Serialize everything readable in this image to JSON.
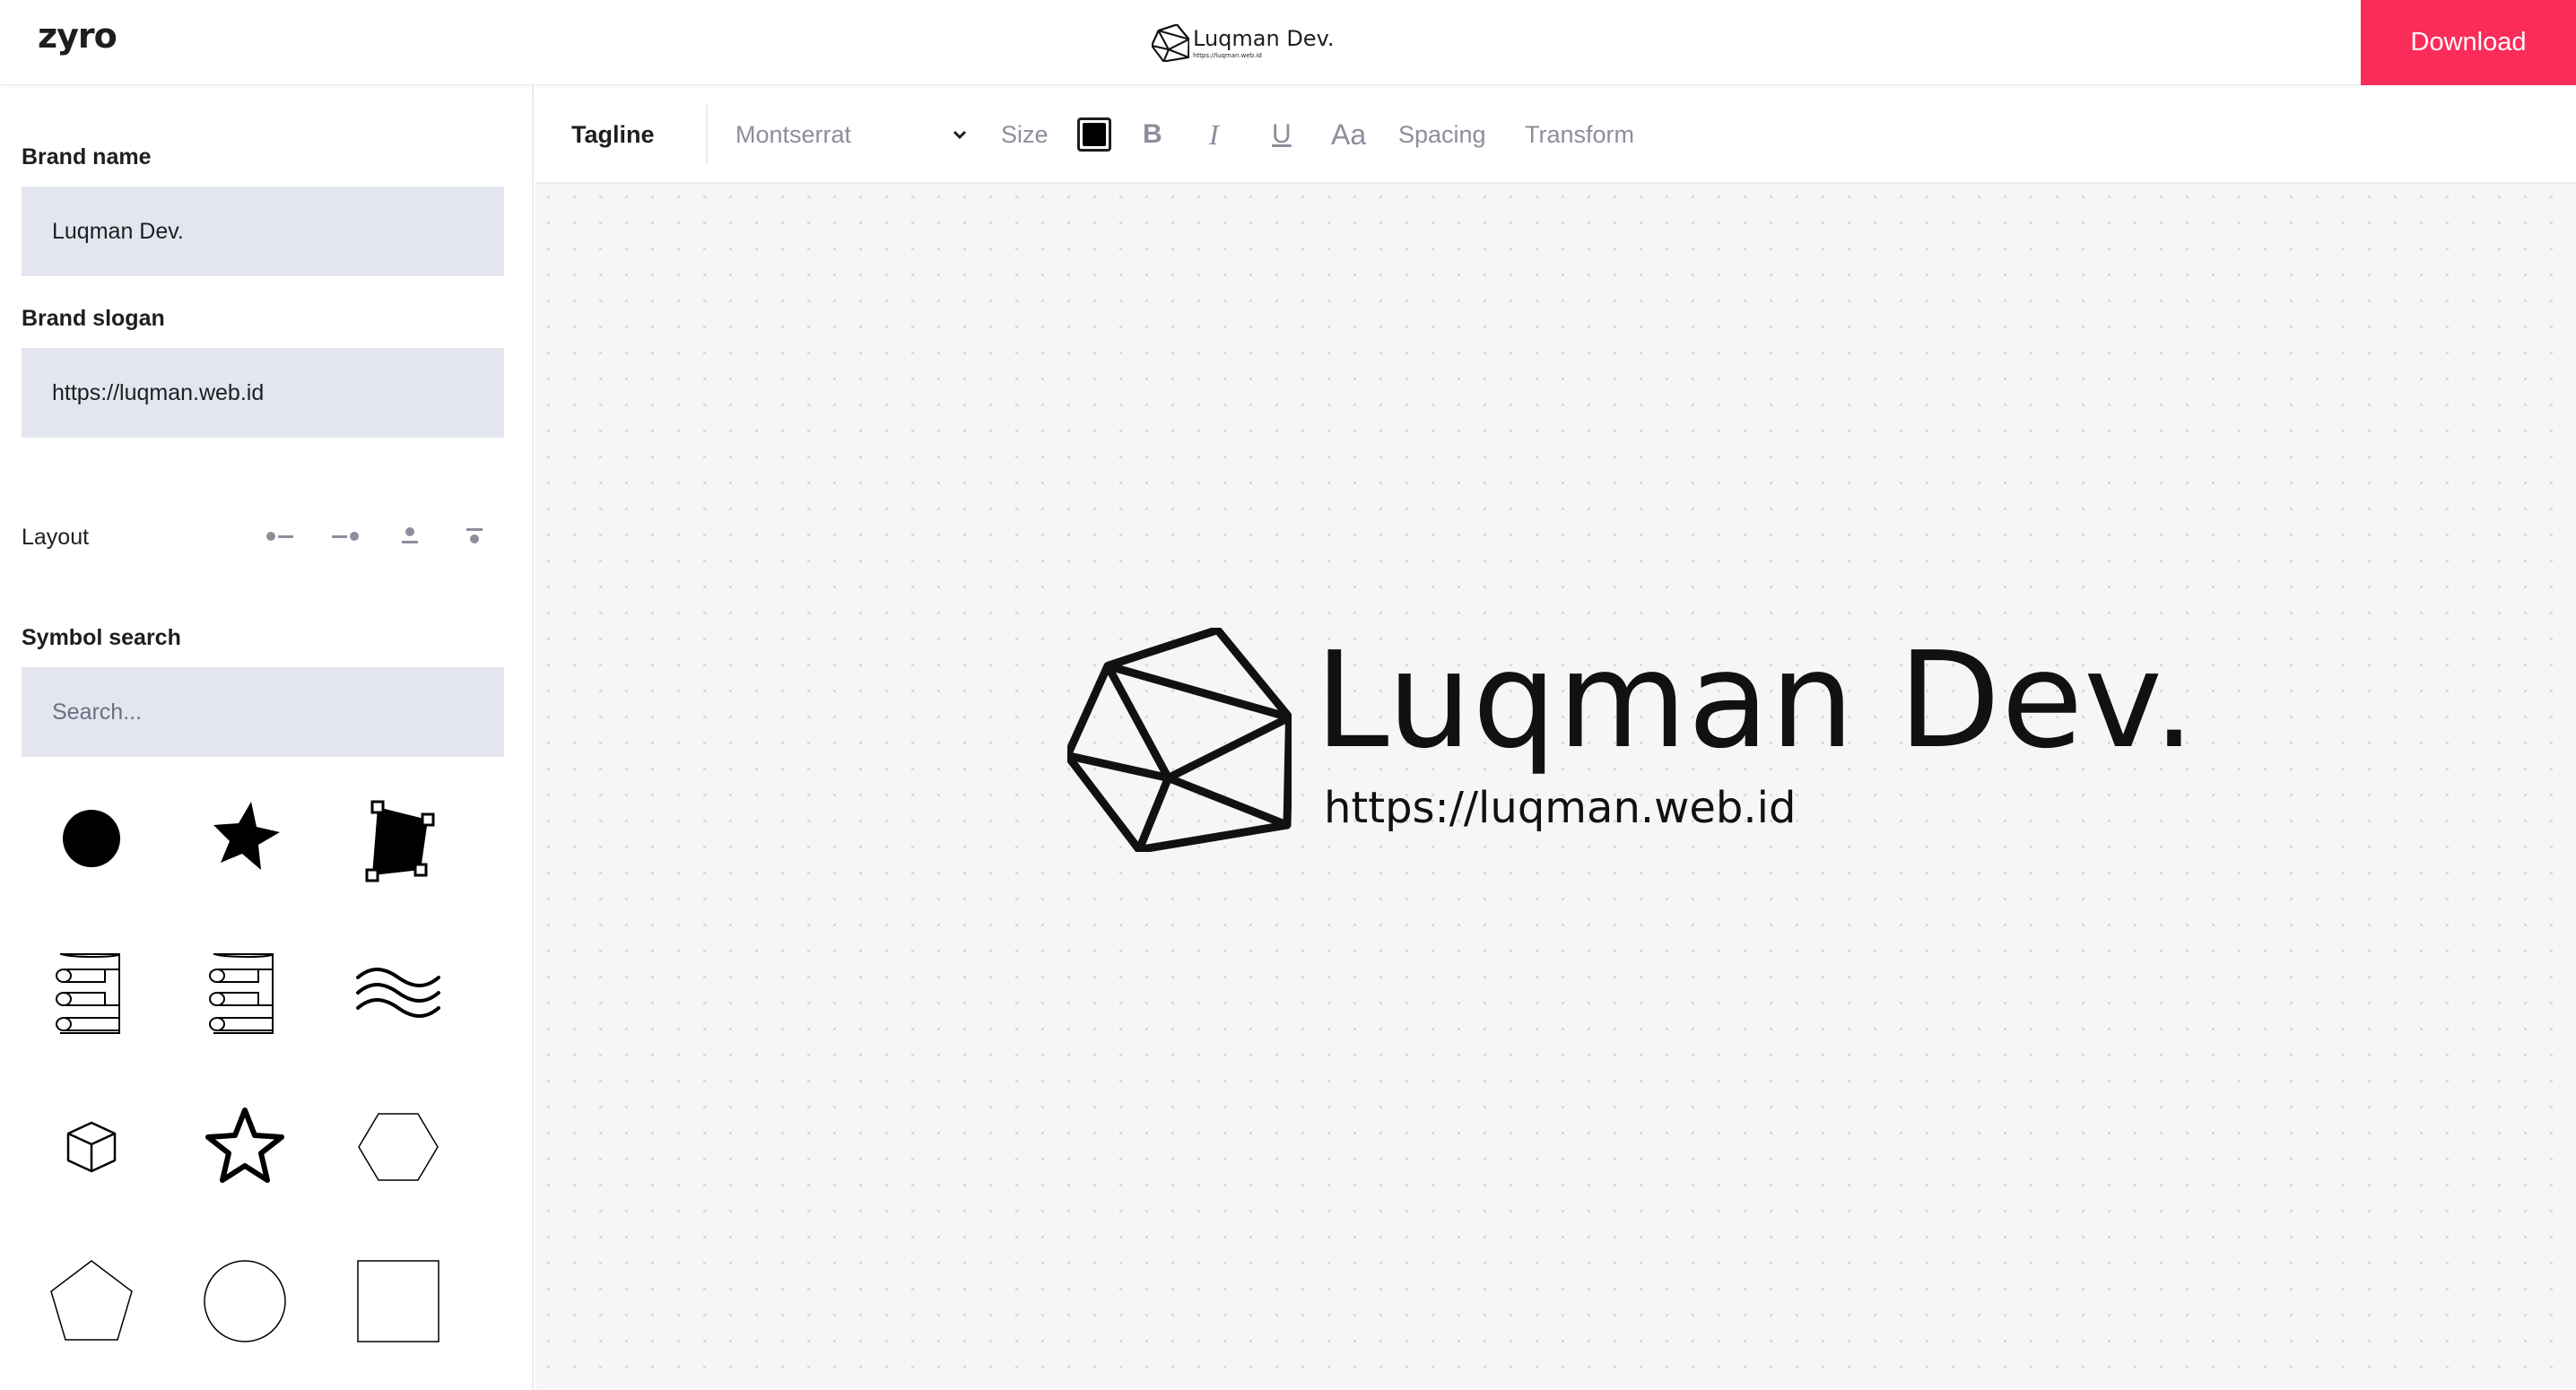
{
  "app": {
    "brand": "zyro"
  },
  "header": {
    "preview_name": "Luqman Dev.",
    "preview_slogan": "https://luqman.web.id",
    "download_label": "Download",
    "accent_color": "#fc2c5a"
  },
  "sidebar": {
    "brand_name_label": "Brand name",
    "brand_name_value": "Luqman Dev.",
    "brand_slogan_label": "Brand slogan",
    "brand_slogan_value": "https://luqman.web.id",
    "layout_label": "Layout",
    "layout_options": [
      "icon-left",
      "icon-right",
      "icon-top",
      "icon-top-centered"
    ],
    "symbol_search_label": "Symbol search",
    "symbol_search_placeholder": "Search...",
    "symbols": [
      "filled-circle-icon",
      "filled-star-icon",
      "transform-square-icon",
      "scroll-left-icon",
      "scroll-right-icon",
      "waves-icon",
      "cube-icon",
      "star-outline-icon",
      "hexagon-icon",
      "pentagon-icon",
      "circle-outline-icon",
      "square-outline-icon"
    ]
  },
  "toolbar": {
    "section_label": "Tagline",
    "font": "Montserrat",
    "size_label": "Size",
    "text_color": "#000000",
    "bold_label": "B",
    "italic_label": "I",
    "underline_label": "U",
    "case_label": "Aa",
    "spacing_label": "Spacing",
    "transform_label": "Transform"
  },
  "canvas": {
    "logo_name": "Luqman Dev.",
    "logo_slogan": "https://luqman.web.id"
  }
}
